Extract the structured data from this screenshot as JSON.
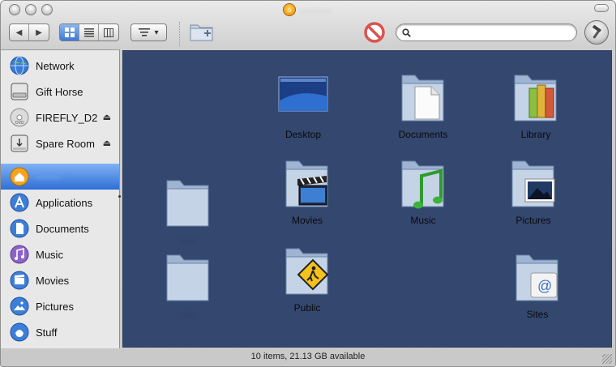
{
  "window": {
    "title": "········",
    "title_icon": "home-icon"
  },
  "toolbar": {
    "back_glyph": "◀",
    "forward_glyph": "▶",
    "view_modes": [
      "icon-view",
      "list-view",
      "column-view"
    ],
    "active_view": "icon-view",
    "search_placeholder": "",
    "search_value": ""
  },
  "sidebar": {
    "devices": [
      {
        "label": "Network",
        "icon": "network-globe-icon",
        "eject": false
      },
      {
        "label": "Gift Horse",
        "icon": "hard-drive-icon",
        "eject": false
      },
      {
        "label": "FIREFLY_D2",
        "icon": "dvd-disc-icon",
        "eject": true
      },
      {
        "label": "Spare Room",
        "icon": "network-drive-icon",
        "eject": true
      }
    ],
    "places": [
      {
        "label": "·······",
        "icon": "home-icon",
        "selected": true
      },
      {
        "label": "Applications",
        "icon": "applications-icon"
      },
      {
        "label": "Documents",
        "icon": "documents-icon"
      },
      {
        "label": "Music",
        "icon": "music-icon"
      },
      {
        "label": "Movies",
        "icon": "movies-icon"
      },
      {
        "label": "Pictures",
        "icon": "pictures-icon"
      },
      {
        "label": "Stuff",
        "icon": "stuff-icon"
      }
    ],
    "eject_glyph": "⏏"
  },
  "content": {
    "background": "#34476f",
    "items": [
      {
        "label": "Desktop",
        "icon": "desktop-folder-icon"
      },
      {
        "label": "Documents",
        "icon": "documents-folder-icon"
      },
      {
        "label": "Library",
        "icon": "library-folder-icon"
      },
      {
        "label": "·····",
        "icon": "folder-icon",
        "blurred": true
      },
      {
        "label": "Movies",
        "icon": "movies-folder-icon"
      },
      {
        "label": "Music",
        "icon": "music-folder-icon"
      },
      {
        "label": "Pictures",
        "icon": "pictures-folder-icon"
      },
      {
        "label": "·····",
        "icon": "folder-icon",
        "blurred": true
      },
      {
        "label": "Public",
        "icon": "public-folder-icon"
      },
      {
        "label": "Sites",
        "icon": "sites-folder-icon"
      }
    ]
  },
  "status_bar": {
    "text": "10 items, 21.13 GB available"
  }
}
